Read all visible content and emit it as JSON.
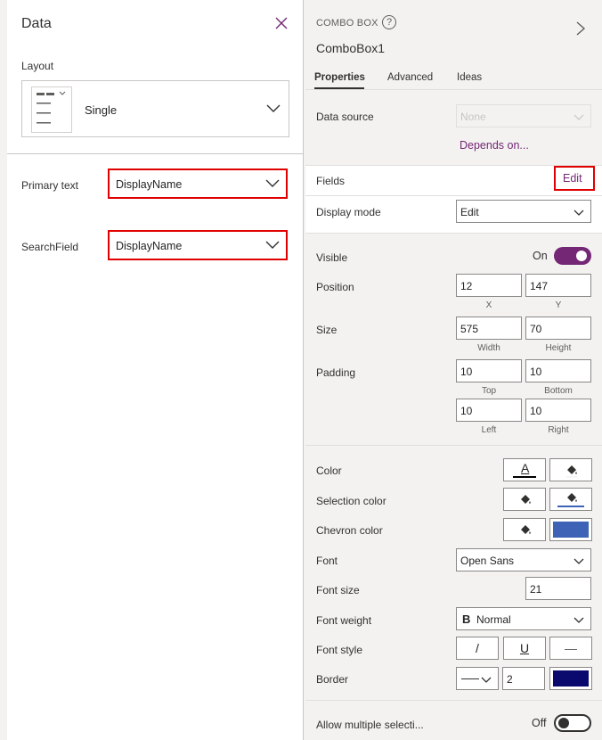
{
  "left": {
    "title": "Data",
    "layout_label": "Layout",
    "layout_value": "Single",
    "fields": [
      {
        "label": "Primary text",
        "value": "DisplayName"
      },
      {
        "label": "SearchField",
        "value": "DisplayName"
      }
    ]
  },
  "right": {
    "kicker": "COMBO BOX",
    "help": "?",
    "title": "ComboBox1",
    "tabs": [
      "Properties",
      "Advanced",
      "Ideas"
    ],
    "data_source_label": "Data source",
    "data_source_value": "None",
    "depends_on": "Depends on...",
    "fields_label": "Fields",
    "fields_edit": "Edit",
    "display_mode_label": "Display mode",
    "display_mode_value": "Edit",
    "visible_label": "Visible",
    "visible_state": "On",
    "position_label": "Position",
    "position_x": "12",
    "position_y": "147",
    "x_label": "X",
    "y_label": "Y",
    "size_label": "Size",
    "size_w": "575",
    "size_h": "70",
    "width_label": "Width",
    "height_label": "Height",
    "padding_label": "Padding",
    "padding_top": "10",
    "padding_bottom": "10",
    "padding_left": "10",
    "padding_right": "10",
    "top_label": "Top",
    "bottom_label": "Bottom",
    "left_label": "Left",
    "right_label": "Right",
    "color_label": "Color",
    "color_glyph": "A",
    "selection_color_label": "Selection color",
    "chevron_color_label": "Chevron color",
    "chevron_color_hex": "#3d62b6",
    "font_label": "Font",
    "font_value": "Open Sans",
    "font_size_label": "Font size",
    "font_size_value": "21",
    "font_weight_label": "Font weight",
    "font_weight_glyph": "B",
    "font_weight_value": "Normal",
    "font_style_label": "Font style",
    "italic_glyph": "/",
    "underline_glyph": "U",
    "strike_glyph": "—",
    "border_label": "Border",
    "border_width": "2",
    "border_color_hex": "#0a0a6e",
    "allow_multi_label": "Allow multiple selecti...",
    "allow_multi_state": "Off"
  },
  "colors": {
    "accent": "#742774",
    "highlight_red": "#e00000",
    "selection_underline": "#3d62b6"
  }
}
